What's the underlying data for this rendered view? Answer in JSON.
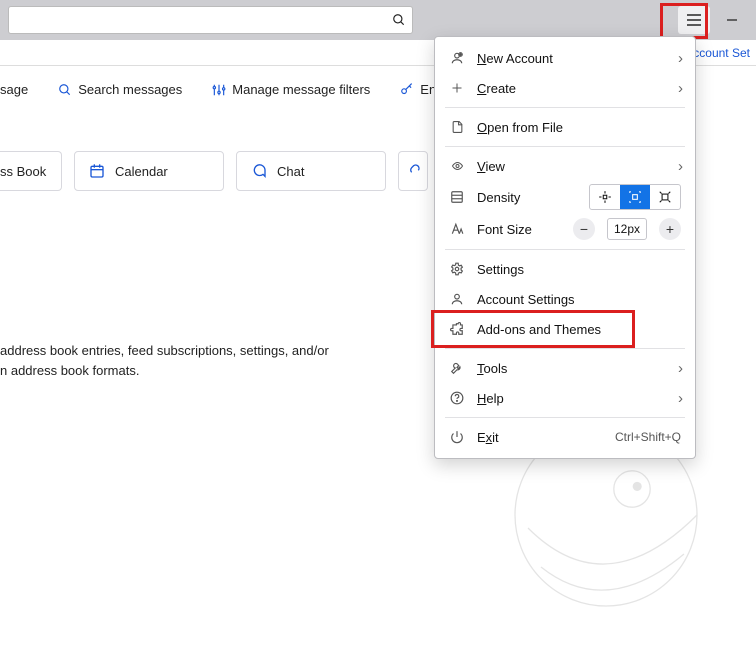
{
  "titlebar": {
    "search_placeholder": "",
    "account_settings_link": "Account Set"
  },
  "toolstrip": {
    "item1_suffix": "sage",
    "search_messages": "Search messages",
    "manage_filters": "Manage message filters",
    "end_to": "End-to"
  },
  "cards": {
    "address_book": "ss Book",
    "calendar": "Calendar",
    "chat": "Chat"
  },
  "description": {
    "line1": "address book entries, feed subscriptions, settings, and/or",
    "line2": "n address book formats."
  },
  "menu": {
    "new_account": "New Account",
    "create": "Create",
    "open_from_file": "Open from File",
    "view": "View",
    "density": "Density",
    "font_size": "Font Size",
    "font_value": "12px",
    "settings": "Settings",
    "account_settings": "Account Settings",
    "addons": "Add-ons and Themes",
    "tools": "Tools",
    "help": "Help",
    "exit": "Exit",
    "exit_shortcut": "Ctrl+Shift+Q"
  }
}
